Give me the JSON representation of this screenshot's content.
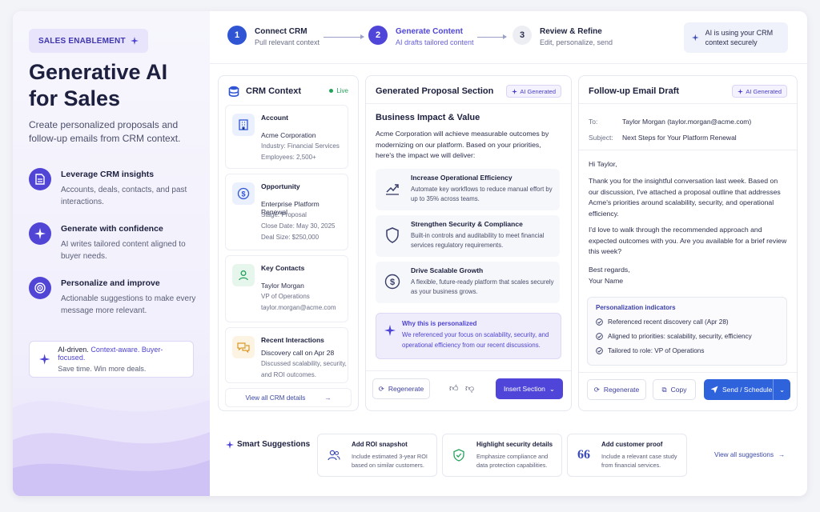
{
  "hero": {
    "badge": "SALES ENABLEMENT",
    "title": "Generative AI for Sales",
    "subtitle": "Create personalized proposals and follow-up emails from CRM context.",
    "features": [
      {
        "title": "Leverage CRM insights",
        "desc": "Accounts, deals, contacts, and past interactions.",
        "icon": "document-icon"
      },
      {
        "title": "Generate with confidence",
        "desc": "AI writes tailored content aligned to buyer needs.",
        "icon": "sparkle-icon"
      },
      {
        "title": "Personalize and improve",
        "desc": "Actionable suggestions to make every message more relevant.",
        "icon": "target-icon"
      }
    ],
    "callout_a": "AI-driven.",
    "callout_b": "Context-aware. Buyer-focused.",
    "callout_line2": "Save time. Win more deals."
  },
  "steps": [
    {
      "num": "1",
      "title": "Connect CRM",
      "desc": "Pull relevant context"
    },
    {
      "num": "2",
      "title": "Generate Content",
      "desc": "AI drafts tailored content"
    },
    {
      "num": "3",
      "title": "Review & Refine",
      "desc": "Edit, personalize, send"
    }
  ],
  "secure_note": "AI is using your CRM context securely",
  "crm": {
    "title": "CRM Context",
    "live": "Live",
    "account": {
      "label": "Account",
      "name": "Acme Corporation",
      "l1": "Industry: Financial Services",
      "l2": "Employees: 2,500+"
    },
    "opportunity": {
      "label": "Opportunity",
      "name": "Enterprise Platform Renewal",
      "l1": "Stage: Proposal",
      "l2": "Close Date: May 30, 2025",
      "l3": "Deal Size: $250,000"
    },
    "contacts": {
      "label": "Key Contacts",
      "name": "Taylor Morgan",
      "l1": "VP of Operations",
      "l2": "taylor.morgan@acme.com"
    },
    "interactions": {
      "label": "Recent Interactions",
      "name": "Discovery call on Apr 28",
      "l1": "Discussed scalability, security,",
      "l2": "and ROI outcomes."
    },
    "view_all": "View all CRM details"
  },
  "proposal": {
    "title": "Generated Proposal Section",
    "tag": "AI Generated",
    "heading": "Business Impact & Value",
    "intro": "Acme Corporation will achieve measurable outcomes by modernizing on our platform. Based on your priorities, here's the impact we will deliver:",
    "items": [
      {
        "title": "Increase Operational Efficiency",
        "desc": "Automate key workflows to reduce manual effort by up to 35% across teams."
      },
      {
        "title": "Strengthen Security & Compliance",
        "desc": "Built-in controls and auditability to meet financial services regulatory requirements."
      },
      {
        "title": "Drive Scalable Growth",
        "desc": "A flexible, future-ready platform that scales securely as your business grows."
      }
    ],
    "why_title": "Why this is personalized",
    "why_desc": "We referenced your focus on scalability, security, and operational efficiency from our recent discussions.",
    "regenerate": "Regenerate",
    "insert": "Insert Section"
  },
  "email": {
    "title": "Follow-up Email Draft",
    "tag": "AI Generated",
    "to_label": "To:",
    "to": "Taylor Morgan (taylor.morgan@acme.com)",
    "subject_label": "Subject:",
    "subject": "Next Steps for Your Platform Renewal",
    "greeting": "Hi Taylor,",
    "p1": "Thank you for the insightful conversation last week. Based on our discussion, I've attached a proposal outline that addresses Acme's priorities around scalability, security, and operational efficiency.",
    "p2": "I'd love to walk through the recommended approach and expected outcomes with you. Are you available for a brief review this week?",
    "signoff1": "Best regards,",
    "signoff2": "Your Name",
    "pers_title": "Personalization indicators",
    "pers_items": [
      "Referenced recent discovery call (Apr 28)",
      "Aligned to priorities: scalability, security, efficiency",
      "Tailored to role: VP of Operations"
    ],
    "regenerate": "Regenerate",
    "copy": "Copy",
    "send": "Send / Schedule"
  },
  "suggestions": {
    "title": "Smart Suggestions",
    "items": [
      {
        "title": "Add ROI snapshot",
        "desc": "Include estimated 3-year ROI based on similar customers."
      },
      {
        "title": "Highlight security details",
        "desc": "Emphasize compliance and data protection capabilities."
      },
      {
        "title": "Add customer proof",
        "desc": "Include a relevant case study from financial services."
      }
    ],
    "view_all": "View all suggestions"
  },
  "colors": {
    "accent": "#4f45d8",
    "blue": "#2f63dc",
    "live": "#22a35a"
  }
}
